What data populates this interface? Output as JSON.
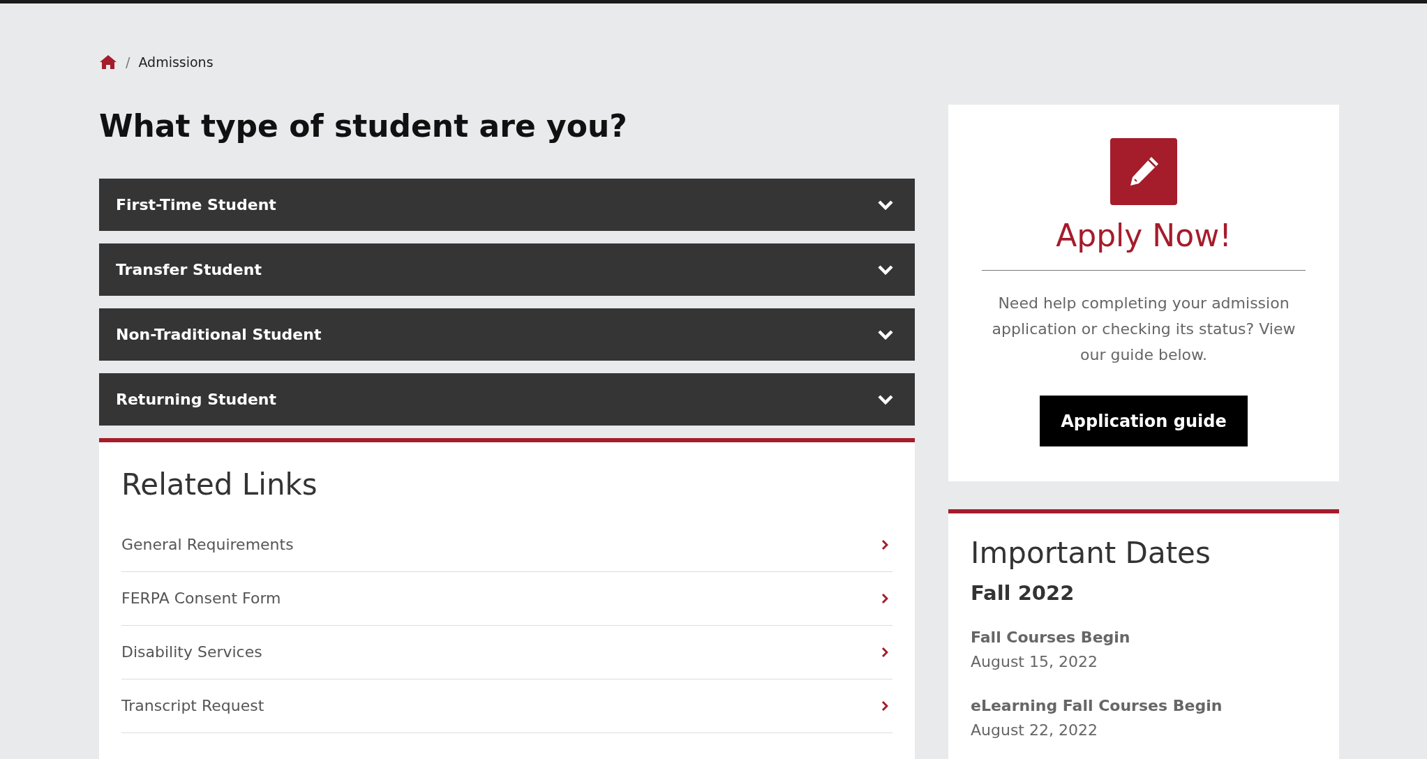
{
  "breadcrumb": {
    "separator": "/",
    "current": "Admissions"
  },
  "heading": "What type of student are you?",
  "accordion": [
    {
      "label": "First-Time Student",
      "expanded": false
    },
    {
      "label": "Transfer Student",
      "expanded": false
    },
    {
      "label": "Non-Traditional Student",
      "expanded": false
    },
    {
      "label": "Returning Student",
      "expanded": false
    }
  ],
  "related_links": {
    "title": "Related Links",
    "items": [
      "General Requirements",
      "FERPA Consent Form",
      "Disability Services",
      "Transcript Request"
    ]
  },
  "apply_card": {
    "title": "Apply Now!",
    "text": "Need help completing your admission application or checking its status? View our guide below.",
    "button": "Application guide"
  },
  "important_dates": {
    "title": "Important Dates",
    "term": "Fall 2022",
    "items": [
      {
        "label": "Fall Courses Begin",
        "date": "August 15, 2022"
      },
      {
        "label": "eLearning Fall Courses Begin",
        "date": "August 22, 2022"
      }
    ]
  }
}
